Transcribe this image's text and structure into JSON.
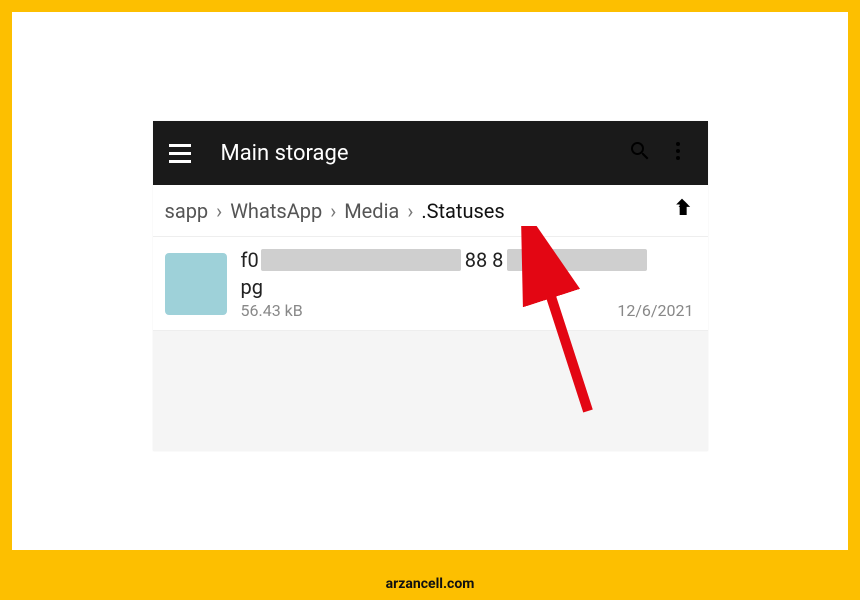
{
  "frame": {
    "watermark": "arzancell.com"
  },
  "appbar": {
    "title": "Main storage"
  },
  "breadcrumb": {
    "items": [
      "sapp",
      "WhatsApp",
      "Media",
      ".Statuses"
    ]
  },
  "file": {
    "name_prefix": "f0",
    "name_mid": "88 8",
    "ext": "pg",
    "size": "56.43 kB",
    "date": "12/6/2021"
  }
}
